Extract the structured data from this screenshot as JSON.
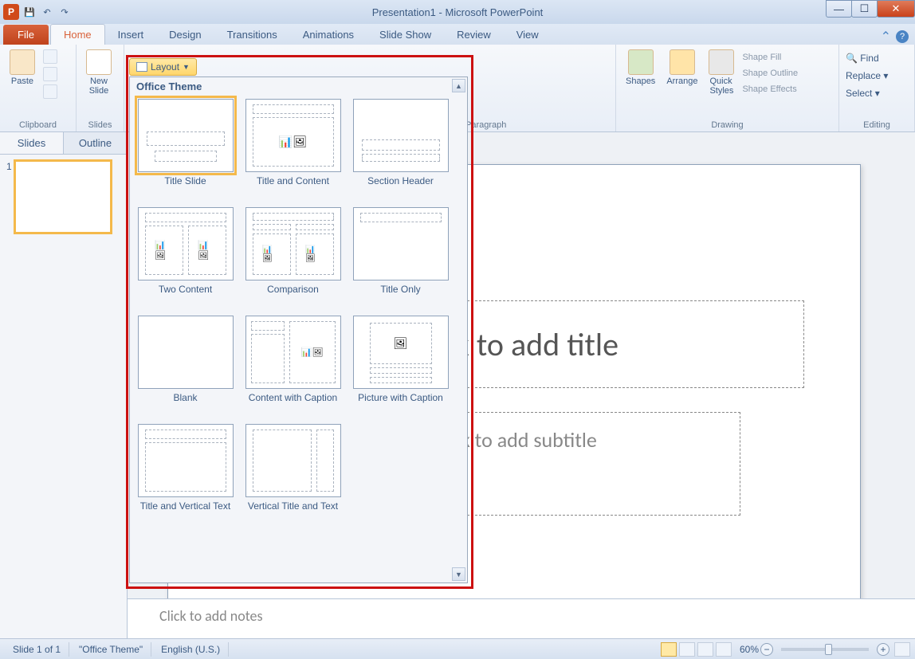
{
  "titlebar": {
    "title": "Presentation1 - Microsoft PowerPoint"
  },
  "tabs": {
    "file": "File",
    "items": [
      "Home",
      "Insert",
      "Design",
      "Transitions",
      "Animations",
      "Slide Show",
      "Review",
      "View"
    ],
    "active": "Home"
  },
  "ribbon": {
    "clipboard": {
      "label": "Clipboard",
      "paste": "Paste"
    },
    "slides": {
      "label": "Slides",
      "newslide": "New\nSlide",
      "layout": "Layout"
    },
    "paragraph": {
      "label": "Paragraph"
    },
    "drawing": {
      "label": "Drawing",
      "shapes": "Shapes",
      "arrange": "Arrange",
      "quick": "Quick\nStyles",
      "fill": "Shape Fill",
      "outline": "Shape Outline",
      "effects": "Shape Effects"
    },
    "editing": {
      "label": "Editing",
      "find": "Find",
      "replace": "Replace",
      "select": "Select"
    }
  },
  "layout_panel": {
    "header": "Office Theme",
    "items": [
      {
        "label": "Title Slide",
        "selected": true
      },
      {
        "label": "Title and Content"
      },
      {
        "label": "Section Header"
      },
      {
        "label": "Two Content"
      },
      {
        "label": "Comparison"
      },
      {
        "label": "Title Only"
      },
      {
        "label": "Blank"
      },
      {
        "label": "Content with Caption"
      },
      {
        "label": "Picture with Caption"
      },
      {
        "label": "Title and Vertical Text"
      },
      {
        "label": "Vertical Title and Text"
      }
    ]
  },
  "leftpane": {
    "tabs": [
      "Slides",
      "Outline"
    ],
    "active": "Slides",
    "slide_num": "1"
  },
  "slide": {
    "title_placeholder": "Click to add title",
    "subtitle_placeholder": "Click to add subtitle"
  },
  "notes": {
    "placeholder": "Click to add notes"
  },
  "statusbar": {
    "slide_info": "Slide 1 of 1",
    "theme": "\"Office Theme\"",
    "language": "English (U.S.)",
    "zoom": "60%"
  }
}
